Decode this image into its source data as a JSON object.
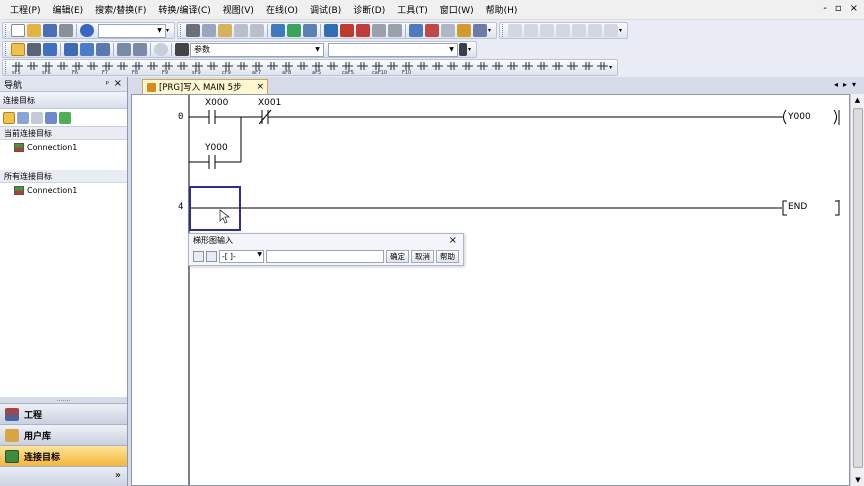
{
  "menu": [
    "工程(P)",
    "编辑(E)",
    "搜索/替换(F)",
    "转换/编译(C)",
    "视图(V)",
    "在线(O)",
    "调试(B)",
    "诊断(D)",
    "工具(T)",
    "窗口(W)",
    "帮助(H)"
  ],
  "window_controls": [
    "-",
    "▫",
    "×"
  ],
  "toolbar": {
    "combo_parameter": "参数"
  },
  "toolbar_row3_labels": [
    "sF5",
    "sF6",
    "F6",
    "F7",
    "F8",
    "F9",
    "sF9",
    "cF9",
    "aF7",
    "aF8",
    "aF5",
    "caF5",
    "caF10",
    "F10"
  ],
  "navigation": {
    "title": "导航",
    "pin": "ᵖ",
    "close": "×",
    "subtitle": "连接目标",
    "current_section": "当前连接目标",
    "current_items": [
      "Connection1"
    ],
    "all_section": "所有连接目标",
    "all_items": [
      "Connection1"
    ],
    "buttons": [
      "工程",
      "用户库",
      "连接目标"
    ],
    "active_button": "连接目标",
    "footer_chevron": "»",
    "splitter": "......."
  },
  "editor": {
    "tab_label": "[PRG]写入 MAIN 5步",
    "tab_close": "×",
    "tab_nav": [
      "◂",
      "▸",
      "▾"
    ],
    "rungs": [
      {
        "step": "0",
        "contacts": [
          "X000",
          "X001"
        ],
        "parallel_contact": "Y000",
        "coil": "Y000"
      },
      {
        "step": "4",
        "coil": "END"
      }
    ]
  },
  "ladder_input": {
    "title": "梯形图输入",
    "close": "×",
    "symbol": "-[ ]-",
    "input_value": "",
    "ok": "确定",
    "cancel": "取消",
    "help": "帮助"
  },
  "colors": {
    "accent": "#f4b63a",
    "cursor": "#2d2d9a",
    "tab": "#fff7d0"
  }
}
